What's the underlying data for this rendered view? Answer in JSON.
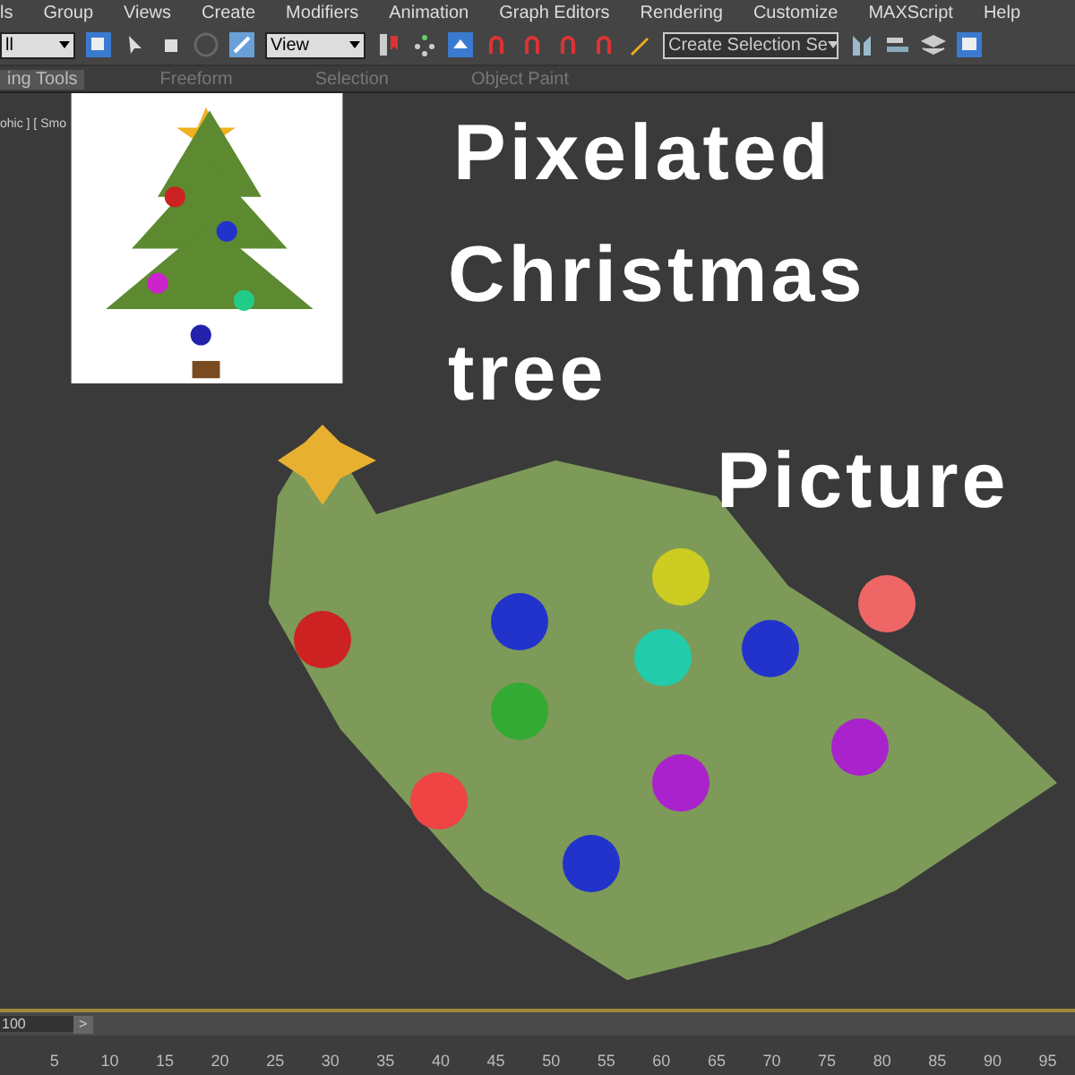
{
  "menu": [
    "ls",
    "Group",
    "Views",
    "Create",
    "Modifiers",
    "Animation",
    "Graph Editors",
    "Rendering",
    "Customize",
    "MAXScript",
    "Help"
  ],
  "toolbar": {
    "selection_filter": "ll",
    "reference_coord": "View",
    "selection_set": "Create Selection Se"
  },
  "ribbon_tabs": [
    {
      "label": "ing Tools",
      "selected": true
    },
    {
      "label": "Freeform",
      "selected": false
    },
    {
      "label": "Selection",
      "selected": false
    },
    {
      "label": "Object Paint",
      "selected": false
    }
  ],
  "viewport": {
    "label": "ohic ] [ Smo",
    "title_lines": [
      "Pixelated",
      "Christmas",
      "tree",
      "Picture"
    ]
  },
  "time_slider": {
    "frame": "100",
    "next": ">"
  },
  "ruler_ticks": [
    "5",
    "10",
    "15",
    "20",
    "25",
    "30",
    "35",
    "40",
    "45",
    "50",
    "55",
    "60",
    "65",
    "70",
    "75",
    "80",
    "85",
    "90",
    "95"
  ]
}
